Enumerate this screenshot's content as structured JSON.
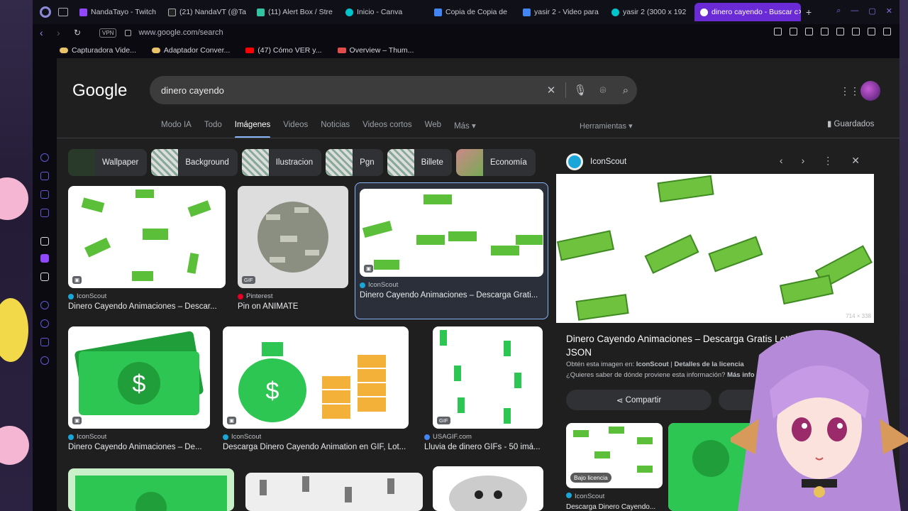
{
  "tabs": [
    {
      "label": "NandaTayo - Twitch",
      "color": "#9146ff"
    },
    {
      "label": "(21) NandaVT (@Ta",
      "color": "#222222"
    },
    {
      "label": "(11) Alert Box / Stre",
      "color": "#31c3a2"
    },
    {
      "label": "Inicio - Canva",
      "color": "#00c4cc"
    },
    {
      "label": "Copia de Copia de",
      "color": "#4285f4"
    },
    {
      "label": "yasir 2 - Video para",
      "color": "#4285f4"
    },
    {
      "label": "yasir 2 (3000 x 192",
      "color": "#00c4cc"
    },
    {
      "label": "dinero cayendo - Buscar c",
      "color": "#ffffff"
    }
  ],
  "address": {
    "vpn": "VPN",
    "url": "www.google.com/search"
  },
  "bookmarks": [
    {
      "label": "Capturadora Vide...",
      "color": "#e8c36a"
    },
    {
      "label": "Adaptador Conver...",
      "color": "#e8c36a"
    },
    {
      "label": "(47) Cómo VER y...",
      "color": "#ff0000"
    },
    {
      "label": "Overview – Thum...",
      "color": "#e34c4c"
    }
  ],
  "google": {
    "logo": "Google",
    "query": "dinero cayendo",
    "nav": [
      "Modo IA",
      "Todo",
      "Imágenes",
      "Videos",
      "Noticias",
      "Videos cortos",
      "Web",
      "Más ▾"
    ],
    "tools": "Herramientas ▾",
    "saved": "Guardados"
  },
  "chips": [
    "Wallpaper",
    "Background",
    "Ilustracion",
    "Pgn",
    "Billete",
    "Economía"
  ],
  "results": [
    {
      "source": "IconScout",
      "title": "Dinero Cayendo Animaciones – Descar...",
      "badge": "▣",
      "src_color": "#1aa6d8"
    },
    {
      "source": "Pinterest",
      "title": "Pin on ANIMATE",
      "badge": "GIF",
      "src_color": "#e60023"
    },
    {
      "source": "IconScout",
      "title": "Dinero Cayendo Animaciones – Descarga Grati...",
      "badge": "▣",
      "src_color": "#1aa6d8"
    },
    {
      "source": "IconScout",
      "title": "Dinero Cayendo Animaciones – De...",
      "badge": "▣",
      "src_color": "#1aa6d8"
    },
    {
      "source": "IconScout",
      "title": "Descarga Dinero Cayendo Animation en GIF, Lot...",
      "badge": "▣",
      "src_color": "#1aa6d8"
    },
    {
      "source": "USAGIF.com",
      "title": "Lluvia de dinero GIFs - 50 imá...",
      "badge": "GIF",
      "src_color": "#4285f4"
    }
  ],
  "panel": {
    "source": "IconScout",
    "dims": "714 × 338",
    "title": "Dinero Cayendo Animaciones – Descarga Gratis Lottie JSON",
    "meta_prefix": "Obtén esta imagen en: ",
    "meta_source": "IconScout",
    "meta_sep": " | ",
    "meta_license": "Detalles de la licencia",
    "question": "¿Quieres saber de dónde proviene esta información? ",
    "more": "Más info",
    "share": "Compartir",
    "related_license": "Bajo licencia",
    "related_source": "IconScout",
    "related_title": "Descarga Dinero Cayendo..."
  }
}
